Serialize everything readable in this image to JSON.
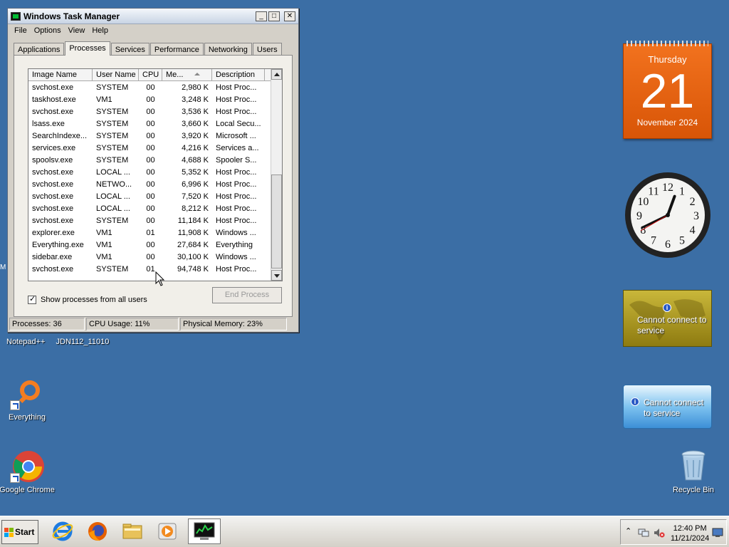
{
  "window": {
    "title": "Windows Task Manager",
    "controls": {
      "minimize": "_",
      "maximize": "□",
      "close": "✕"
    },
    "menu": [
      "File",
      "Options",
      "View",
      "Help"
    ],
    "tabs": [
      "Applications",
      "Processes",
      "Services",
      "Performance",
      "Networking",
      "Users"
    ],
    "active_tab": "Processes"
  },
  "process_list": {
    "columns": [
      "Image Name",
      "User Name",
      "CPU",
      "Me...",
      "Description"
    ],
    "rows": [
      {
        "name": "svchost.exe",
        "user": "SYSTEM",
        "cpu": "00",
        "mem": "2,980 K",
        "desc": "Host Proc..."
      },
      {
        "name": "taskhost.exe",
        "user": "VM1",
        "cpu": "00",
        "mem": "3,248 K",
        "desc": "Host Proc..."
      },
      {
        "name": "svchost.exe",
        "user": "SYSTEM",
        "cpu": "00",
        "mem": "3,536 K",
        "desc": "Host Proc..."
      },
      {
        "name": "lsass.exe",
        "user": "SYSTEM",
        "cpu": "00",
        "mem": "3,660 K",
        "desc": "Local Secu..."
      },
      {
        "name": "SearchIndexe...",
        "user": "SYSTEM",
        "cpu": "00",
        "mem": "3,920 K",
        "desc": "Microsoft ..."
      },
      {
        "name": "services.exe",
        "user": "SYSTEM",
        "cpu": "00",
        "mem": "4,216 K",
        "desc": "Services a..."
      },
      {
        "name": "spoolsv.exe",
        "user": "SYSTEM",
        "cpu": "00",
        "mem": "4,688 K",
        "desc": "Spooler S..."
      },
      {
        "name": "svchost.exe",
        "user": "LOCAL ...",
        "cpu": "00",
        "mem": "5,352 K",
        "desc": "Host Proc..."
      },
      {
        "name": "svchost.exe",
        "user": "NETWO...",
        "cpu": "00",
        "mem": "6,996 K",
        "desc": "Host Proc..."
      },
      {
        "name": "svchost.exe",
        "user": "LOCAL ...",
        "cpu": "00",
        "mem": "7,520 K",
        "desc": "Host Proc..."
      },
      {
        "name": "svchost.exe",
        "user": "LOCAL ...",
        "cpu": "00",
        "mem": "8,212 K",
        "desc": "Host Proc..."
      },
      {
        "name": "svchost.exe",
        "user": "SYSTEM",
        "cpu": "00",
        "mem": "11,184 K",
        "desc": "Host Proc..."
      },
      {
        "name": "explorer.exe",
        "user": "VM1",
        "cpu": "01",
        "mem": "11,908 K",
        "desc": "Windows ..."
      },
      {
        "name": "Everything.exe",
        "user": "VM1",
        "cpu": "00",
        "mem": "27,684 K",
        "desc": "Everything"
      },
      {
        "name": "sidebar.exe",
        "user": "VM1",
        "cpu": "00",
        "mem": "30,100 K",
        "desc": "Windows ..."
      },
      {
        "name": "svchost.exe",
        "user": "SYSTEM",
        "cpu": "01",
        "mem": "94,748 K",
        "desc": "Host Proc..."
      }
    ]
  },
  "show_all_label": "Show processes from all users",
  "show_all_checked": true,
  "end_process_label": "End Process",
  "status": {
    "processes": "Processes: 36",
    "cpu": "CPU Usage: 11%",
    "memory": "Physical Memory: 23%"
  },
  "desktop": {
    "left_edge_text": "M",
    "label_row": [
      "Notepad++",
      "JDN112_11010"
    ],
    "icons": [
      {
        "label": "Everything",
        "icon": "everything-icon"
      },
      {
        "label": "Google Chrome",
        "icon": "chrome-icon"
      },
      {
        "label": "Recycle Bin",
        "icon": "recycle-bin-icon"
      }
    ]
  },
  "calendar": {
    "weekday": "Thursday",
    "day": "21",
    "month_year": "November 2024"
  },
  "clock": {
    "hour": 12,
    "minute": 40,
    "second": 40,
    "numerals": [
      "12",
      "1",
      "2",
      "3",
      "4",
      "5",
      "6",
      "7",
      "8",
      "9",
      "10",
      "11"
    ]
  },
  "weather_gadget": {
    "message": "Cannot connect to service"
  },
  "feed_gadget": {
    "message": "Cannot connect to service"
  },
  "taskbar": {
    "start_label": "Start",
    "pinned": [
      "internet-explorer-icon",
      "firefox-icon",
      "file-explorer-icon",
      "media-player-icon",
      "task-manager-icon"
    ],
    "active": "task-manager-icon",
    "tray": {
      "time": "12:40 PM",
      "date": "11/21/2024"
    }
  },
  "colors": {
    "desktop": "#3b6ea5",
    "calendar": "#e8620f",
    "weather": "#b3a226",
    "feed": "#5aaae8"
  }
}
